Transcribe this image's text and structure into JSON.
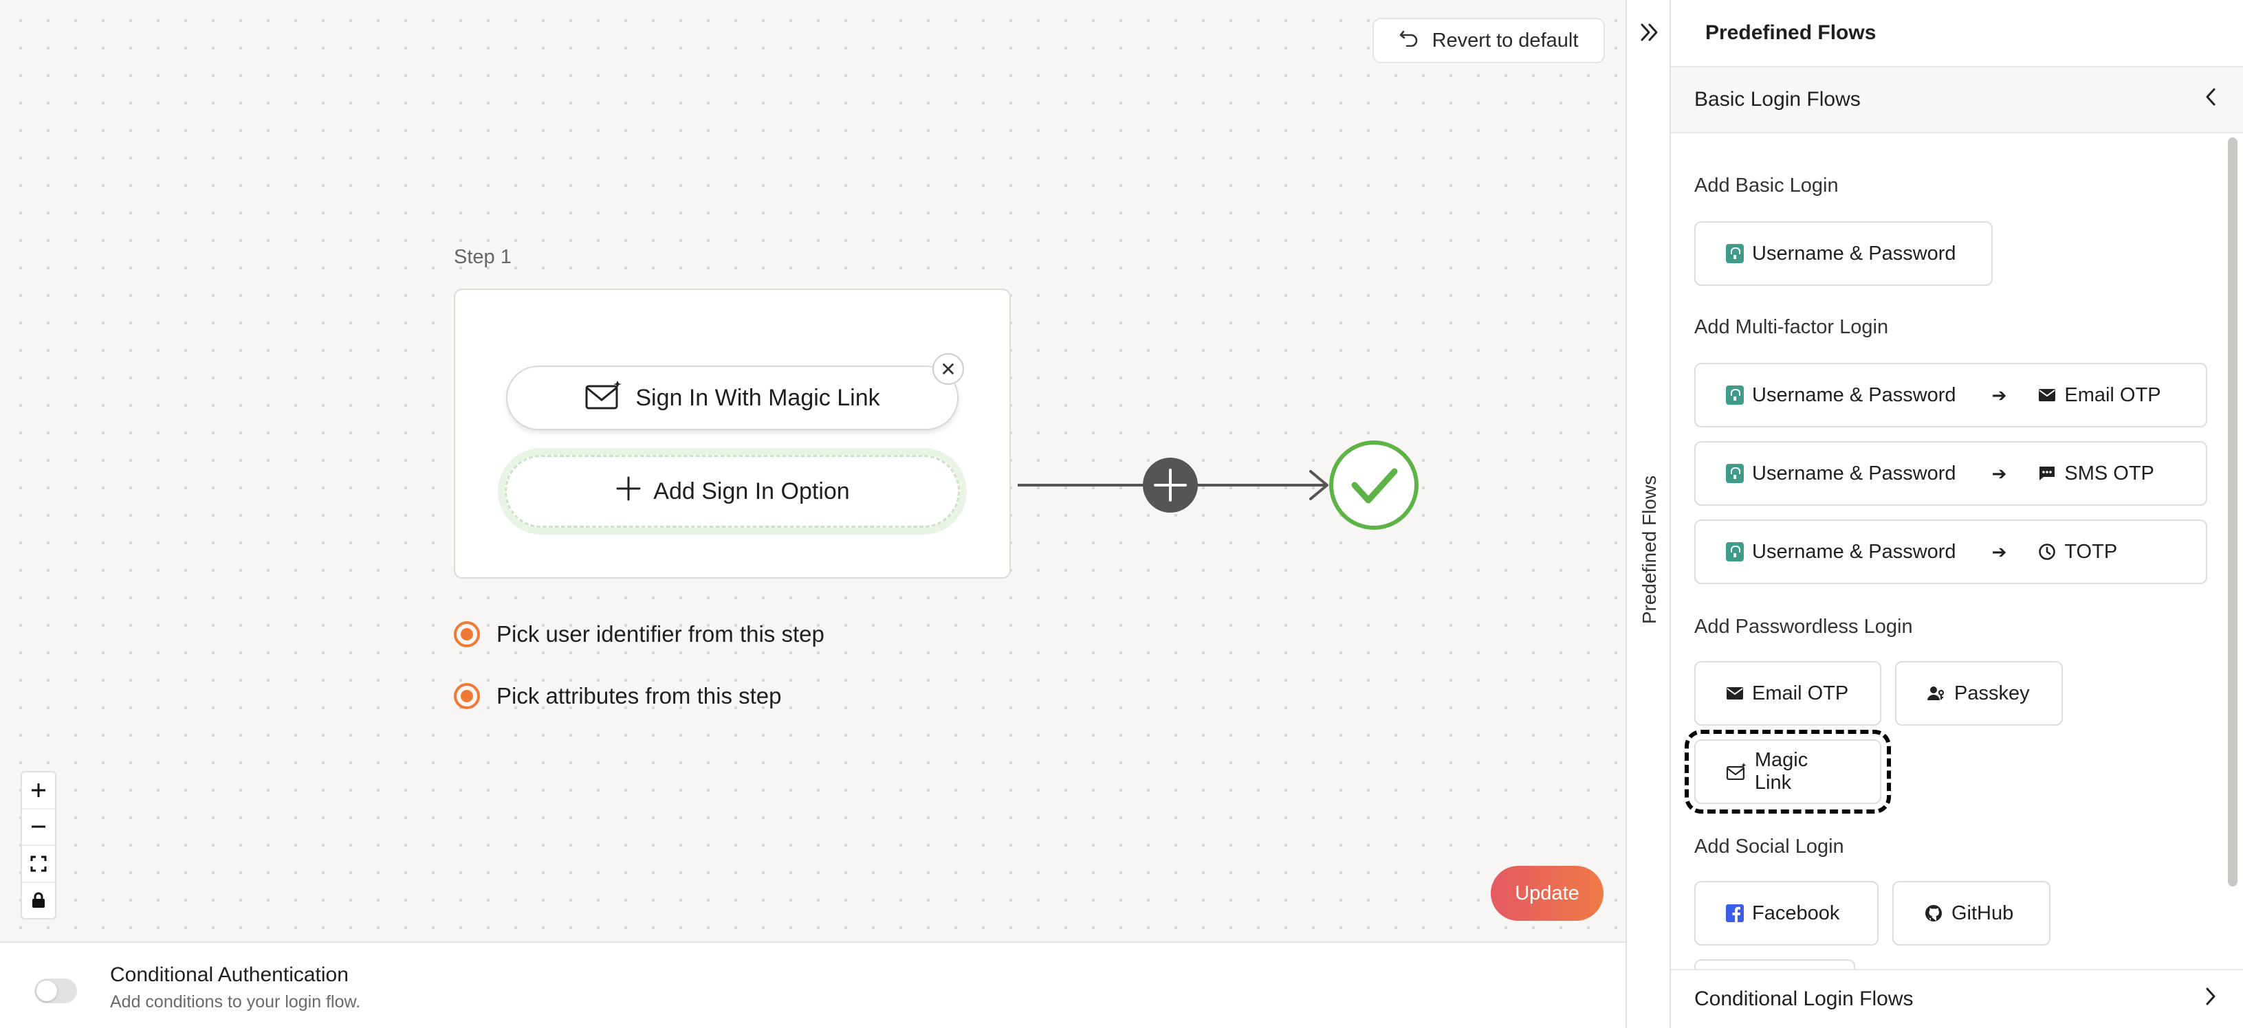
{
  "canvas": {
    "revert_label": "Revert to default",
    "step_label": "Step 1",
    "sign_in_option": "Sign In With Magic Link",
    "add_option": "Add Sign In Option",
    "radio_options": [
      "Pick user identifier from this step",
      "Pick attributes from this step"
    ],
    "update_label": "Update"
  },
  "bottom_bar": {
    "title": "Conditional Authentication",
    "subtitle": "Add conditions to your login flow."
  },
  "rail": {
    "label": "Predefined Flows"
  },
  "panel": {
    "title": "Predefined Flows",
    "section": "Basic Login Flows",
    "groups": {
      "basic": {
        "title": "Add Basic Login",
        "items": [
          "Username & Password"
        ]
      },
      "mfa": {
        "title": "Add Multi-factor Login",
        "rows": [
          {
            "first": "Username & Password",
            "second": "Email OTP"
          },
          {
            "first": "Username & Password",
            "second": "SMS OTP"
          },
          {
            "first": "Username & Password",
            "second": "TOTP"
          }
        ]
      },
      "passwordless": {
        "title": "Add Passwordless Login",
        "items": [
          "Email OTP",
          "Passkey",
          "Magic Link"
        ]
      },
      "social": {
        "title": "Add Social Login",
        "items": [
          "Facebook",
          "GitHub"
        ]
      }
    },
    "footer_section": "Conditional Login Flows"
  },
  "colors": {
    "accent_orange": "#f07a35",
    "success_green": "#5db346",
    "lock_teal": "#3f9b8a",
    "facebook_blue": "#3b5de7",
    "update_gradient_start": "#e45a63",
    "update_gradient_end": "#f07a47"
  }
}
